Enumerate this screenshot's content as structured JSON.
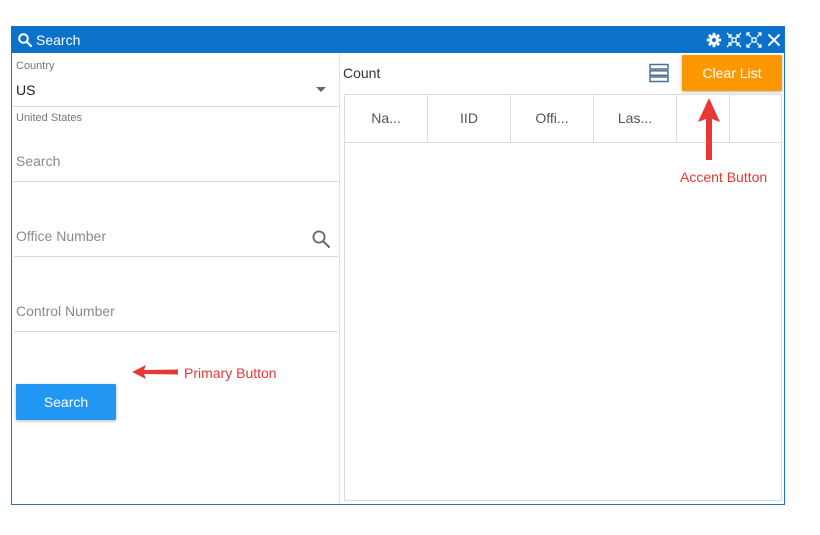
{
  "window": {
    "title": "Search",
    "icons": {
      "search": "search-icon",
      "settings": "gear-icon",
      "shrink": "shrink-icon",
      "expand": "expand-icon",
      "close": "close-icon"
    }
  },
  "form": {
    "country_label": "Country",
    "country_value": "US",
    "country_helper": "United States",
    "search_placeholder": "Search",
    "office_placeholder": "Office Number",
    "control_placeholder": "Control Number",
    "search_button": "Search"
  },
  "list": {
    "count_label": "Count",
    "clear_button": "Clear List",
    "columns": [
      "Na...",
      "IID",
      "Offi...",
      "Las...",
      "",
      ""
    ]
  },
  "annotations": {
    "primary": "Primary Button",
    "accent": "Accent Button"
  },
  "colors": {
    "titlebar": "#0a72c9",
    "primary": "#2196f3",
    "accent": "#ff9800",
    "annotation": "#e53935"
  }
}
